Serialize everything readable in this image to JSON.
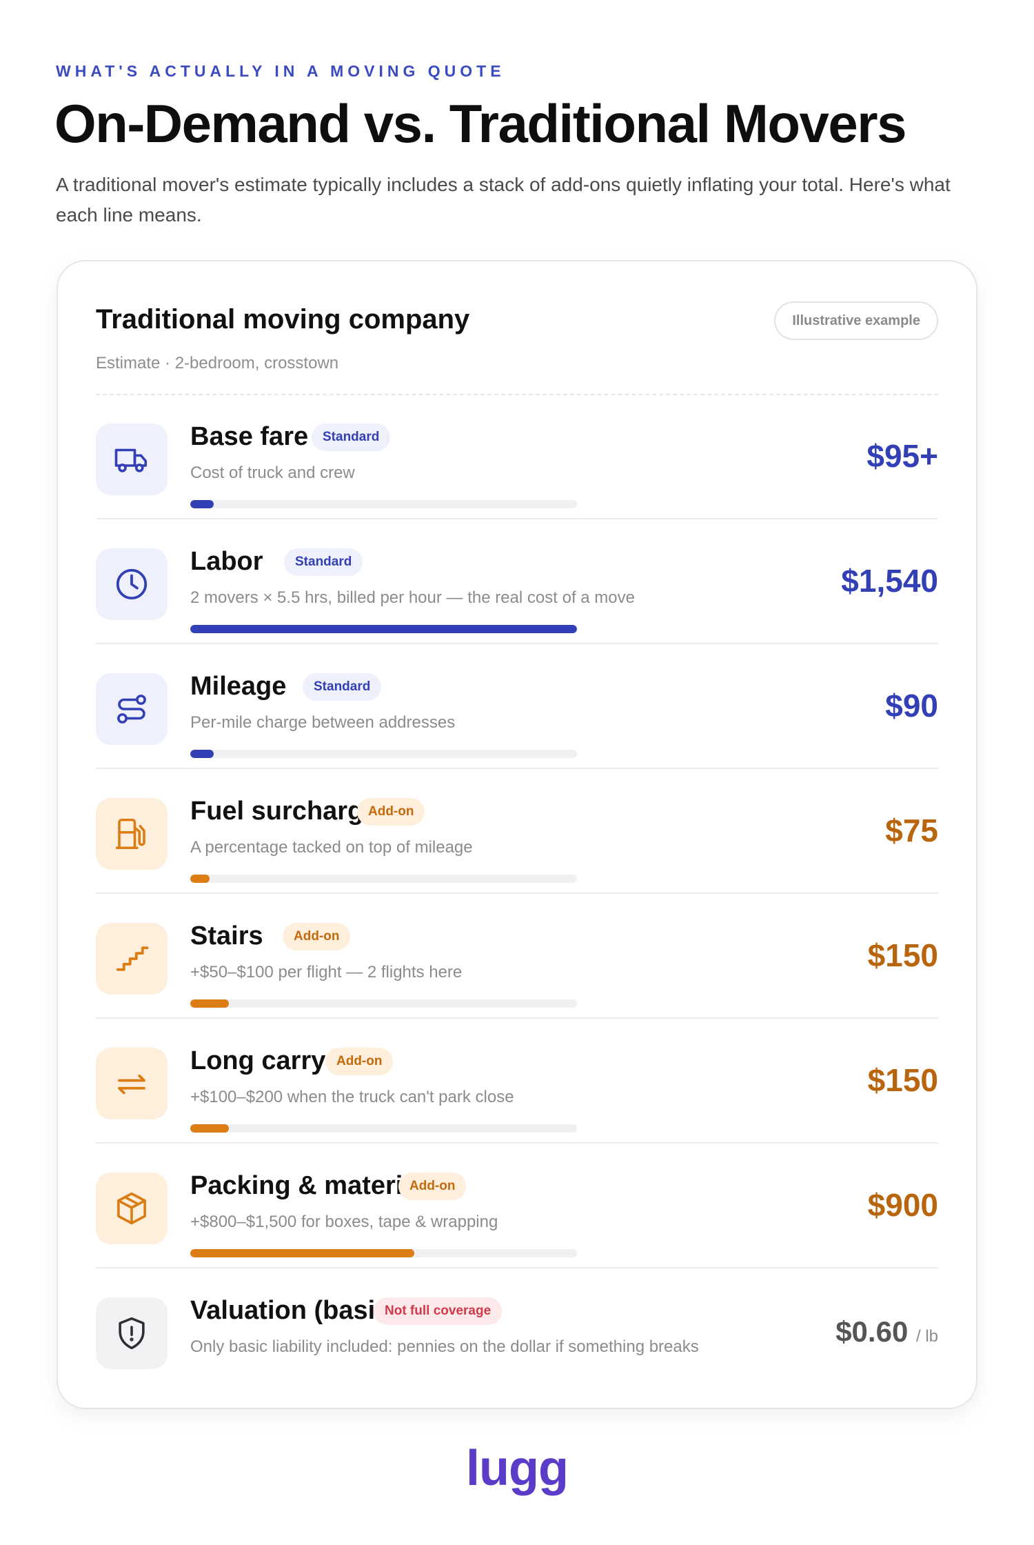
{
  "header": {
    "eyebrow": "WHAT'S ACTUALLY IN A MOVING QUOTE",
    "title": "On-Demand vs. Traditional Movers",
    "intro": "A traditional mover's estimate typically includes a stack of add-ons quietly inflating your total. Here's what each line means."
  },
  "card": {
    "title": "Traditional moving company",
    "badge": "Illustrative example",
    "subtitle": "Estimate · 2-bedroom, crosstown"
  },
  "items": [
    {
      "name": "Base fare",
      "tag": "Standard",
      "description": "Cost of truck and crew",
      "price": "$95+",
      "icon": "truck-icon",
      "color": "#3340b5",
      "bar_fraction": 0.06
    },
    {
      "name": "Labor",
      "tag": "Standard",
      "description": "2 movers × 5.5 hrs, billed per hour — the real cost of a move",
      "price": "$1,540",
      "icon": "clock-icon",
      "color": "#3340b5",
      "bar_fraction": 1.0
    },
    {
      "name": "Mileage",
      "tag": "Standard",
      "description": "Per-mile charge between addresses",
      "price": "$90",
      "icon": "route-icon",
      "color": "#3340b5",
      "bar_fraction": 0.06
    },
    {
      "name": "Fuel surcharge",
      "tag": "Add-on",
      "description": "A percentage tacked on top of mileage",
      "price": "$75",
      "icon": "fuel-pump-icon",
      "color": "#db7d14",
      "bar_fraction": 0.05
    },
    {
      "name": "Stairs",
      "tag": "Add-on",
      "description": "+$50–$100 per flight — 2 flights here",
      "price": "$150",
      "icon": "stairs-icon",
      "color": "#db7d14",
      "bar_fraction": 0.1
    },
    {
      "name": "Long carry",
      "tag": "Add-on",
      "description": "+$100–$200 when the truck can't park close",
      "price": "$150",
      "icon": "double-arrow-icon",
      "color": "#db7d14",
      "bar_fraction": 0.1
    },
    {
      "name": "Packing & materials",
      "tag": "Add-on",
      "description": "+$800–$1,500 for boxes, tape & wrapping",
      "price": "$900",
      "icon": "box-icon",
      "color": "#db7d14",
      "bar_fraction": 0.58
    },
    {
      "name": "Valuation (basic)",
      "tag": "Not full coverage",
      "description": "Only basic liability included: pennies on the dollar if something breaks",
      "price": "$0.60",
      "price_unit": "/ lb",
      "icon": "shield-icon",
      "color": "#555555"
    }
  ],
  "brand": {
    "logo_text": "lugg",
    "color": "#5b3cc8"
  }
}
